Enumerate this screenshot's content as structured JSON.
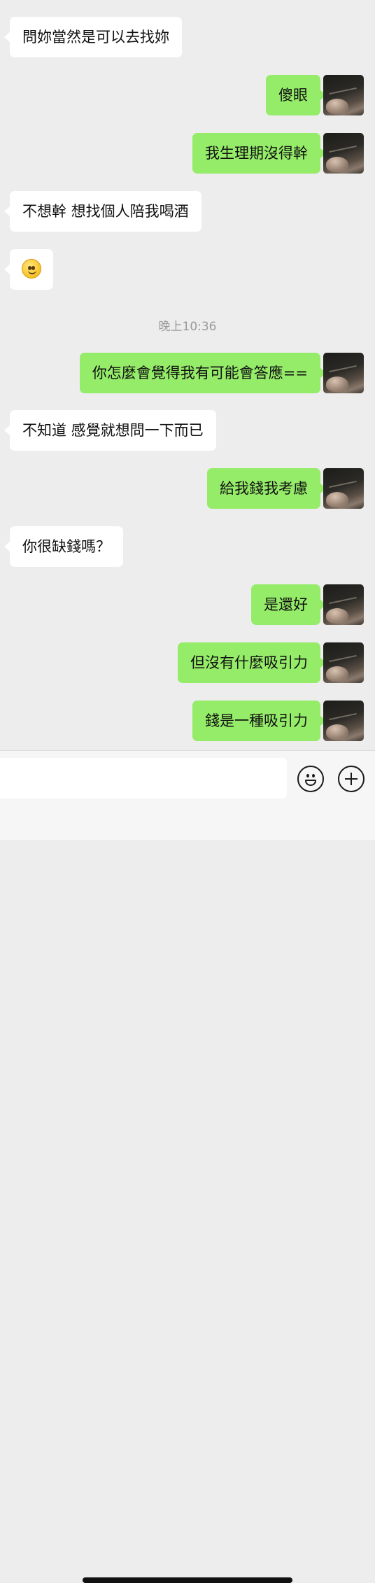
{
  "messages": [
    {
      "side": "in",
      "text": "問妳當然是可以去找妳"
    },
    {
      "side": "out",
      "text": "傻眼"
    },
    {
      "side": "out",
      "text": "我生理期沒得幹"
    },
    {
      "side": "in",
      "text": "不想幹 想找個人陪我喝酒"
    },
    {
      "side": "in",
      "text": "",
      "emoji": "smiling-face-emoji"
    },
    {
      "side": "out",
      "text": "你怎麼會覺得我有可能會答應=="
    },
    {
      "side": "in",
      "text": "不知道 感覺就想問一下而已"
    },
    {
      "side": "out",
      "text": "給我錢我考慮"
    },
    {
      "side": "in",
      "text": "你很缺錢嗎？"
    },
    {
      "side": "out",
      "text": "是還好"
    },
    {
      "side": "out",
      "text": "但沒有什麼吸引力"
    },
    {
      "side": "out",
      "text": "錢是一種吸引力"
    }
  ],
  "timestamp": "晚上10:36",
  "input": {
    "value": "",
    "placeholder": ""
  },
  "colors": {
    "outgoing": "#95ec69",
    "incoming": "#ffffff",
    "background": "#ededed"
  },
  "icons": {
    "emoji_button": "smiley-face-icon",
    "more_button": "plus-circle-icon"
  }
}
